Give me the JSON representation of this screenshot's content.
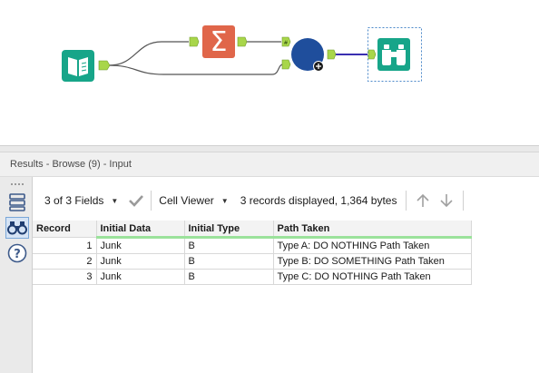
{
  "workflow": {
    "connection_colors": {
      "data": "#555555",
      "selected": "#3a2fb0"
    },
    "tools": [
      {
        "name": "input-data-tool",
        "icon": "book-icon",
        "color": "#17a589"
      },
      {
        "name": "summarize-tool",
        "icon": "sigma-icon",
        "color": "#e0664a"
      },
      {
        "name": "join-tool",
        "icon": "circle-icon",
        "color": "#1f4e9c"
      },
      {
        "name": "browse-tool",
        "icon": "binoculars-icon",
        "color": "#17a589"
      }
    ]
  },
  "results": {
    "title": "Results - Browse (9) - Input"
  },
  "toolbar": {
    "fields_label": "3 of 3 Fields",
    "viewer_label": "Cell Viewer",
    "status": "3 records displayed, 1,364 bytes"
  },
  "table": {
    "columns": [
      "Record",
      "Initial Data",
      "Initial Type",
      "Path Taken"
    ],
    "rows": [
      {
        "record": "1",
        "initial_data": "Junk",
        "initial_type": "B",
        "path_taken": "Type A: DO NOTHING Path Taken"
      },
      {
        "record": "2",
        "initial_data": "Junk",
        "initial_type": "B",
        "path_taken": "Type B: DO SOMETHING Path Taken"
      },
      {
        "record": "3",
        "initial_data": "Junk",
        "initial_type": "B",
        "path_taken": "Type C: DO NOTHING Path Taken"
      }
    ]
  }
}
